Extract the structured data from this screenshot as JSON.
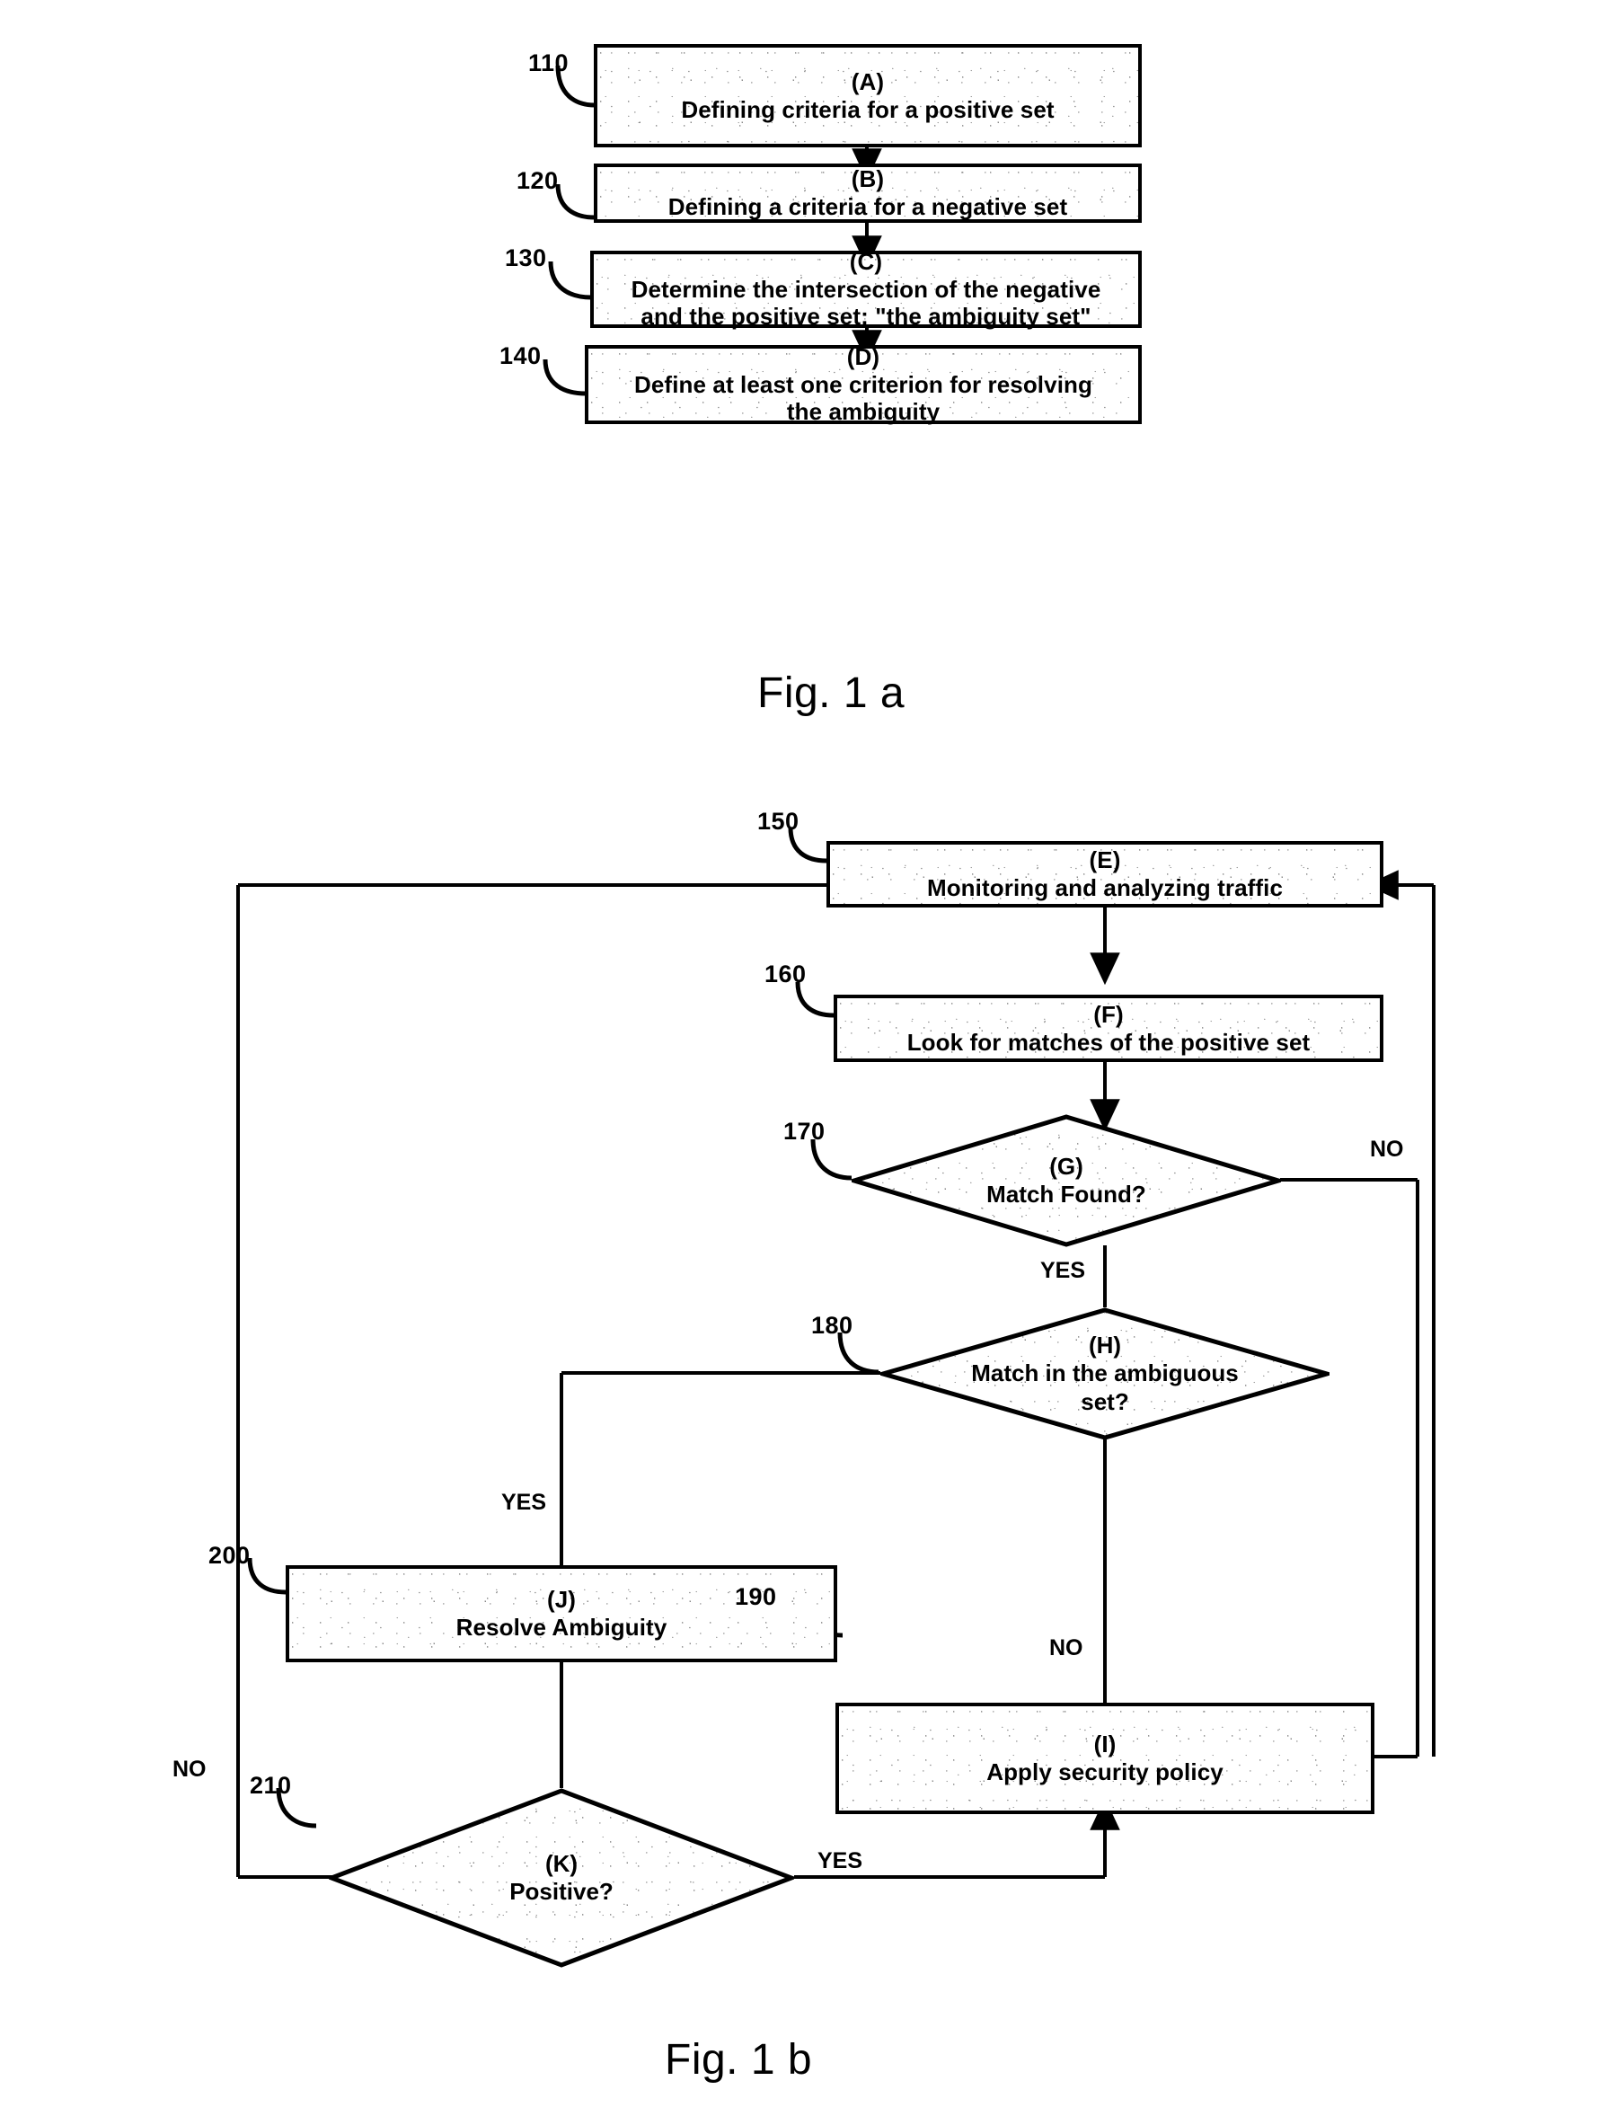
{
  "document": {
    "kind": "patent-flowchart",
    "figures": [
      "Fig. 1 a",
      "Fig. 1 b"
    ]
  },
  "fig1a": {
    "caption": "Fig. 1 a",
    "nodes": [
      {
        "ref": "110",
        "tag": "(A)",
        "line1": "Defining criteria for a positive set",
        "line2": "",
        "shape": "process"
      },
      {
        "ref": "120",
        "tag": "(B)",
        "line1": "Defining a criteria for a negative set",
        "line2": "",
        "shape": "process"
      },
      {
        "ref": "130",
        "tag": "(C)",
        "line1": "Determine the intersection of the negative",
        "line2": "and the positive set: \"the ambiguity set\"",
        "shape": "process"
      },
      {
        "ref": "140",
        "tag": "(D)",
        "line1": "Define at least one criterion for resolving",
        "line2": "the ambiguity",
        "shape": "process"
      }
    ]
  },
  "fig1b": {
    "caption": "Fig. 1 b",
    "nodes": [
      {
        "ref": "150",
        "tag": "(E)",
        "line1": "Monitoring and analyzing traffic",
        "line2": "",
        "shape": "process"
      },
      {
        "ref": "160",
        "tag": "(F)",
        "line1": "Look for matches of the positive set",
        "line2": "",
        "shape": "process"
      },
      {
        "ref": "170",
        "tag": "(G)",
        "line1": "Match Found?",
        "line2": "",
        "shape": "decision"
      },
      {
        "ref": "180",
        "tag": "(H)",
        "line1": "Match in the ambiguous",
        "line2": "set?",
        "shape": "decision"
      },
      {
        "ref": "190",
        "tag": "(I)",
        "line1": "Apply security policy",
        "line2": "",
        "shape": "process"
      },
      {
        "ref": "200",
        "tag": "(J)",
        "line1": "Resolve Ambiguity",
        "line2": "",
        "shape": "process"
      },
      {
        "ref": "210",
        "tag": "(K)",
        "line1": "Positive?",
        "line2": "",
        "shape": "decision"
      }
    ],
    "edge_labels": {
      "g_no": "NO",
      "g_yes": "YES",
      "h_yes": "YES",
      "h_no": "NO",
      "k_yes": "YES",
      "k_no": "NO"
    }
  }
}
